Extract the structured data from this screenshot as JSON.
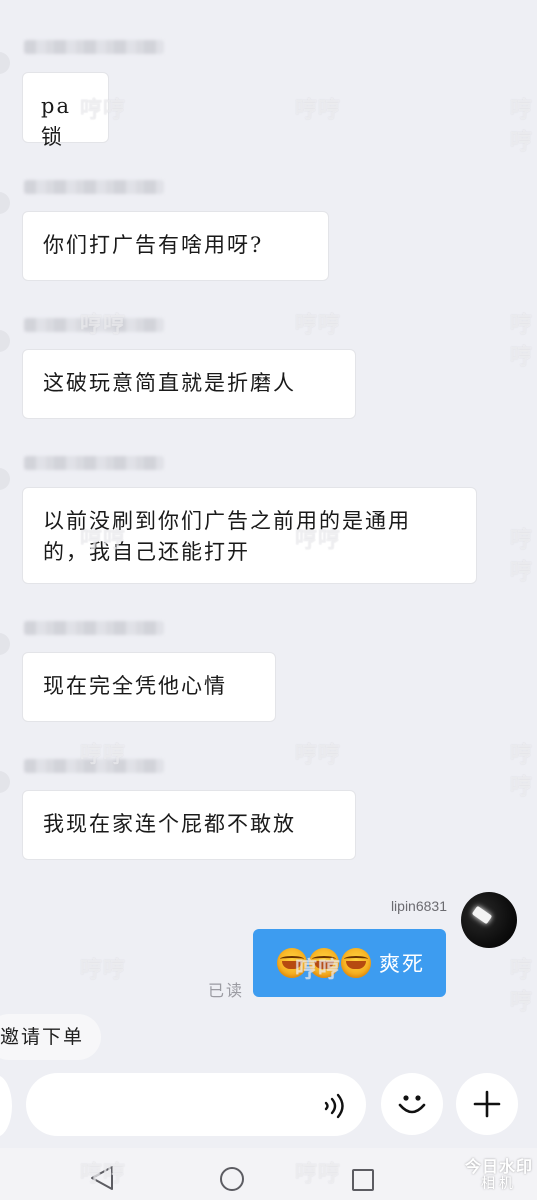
{
  "messages": [
    {
      "text": "pa锁"
    },
    {
      "text": "你们打广告有啥用呀?"
    },
    {
      "text": "这破玩意简直就是折磨人"
    },
    {
      "text": "以前没刷到你们广告之前用的是通用的，我自己还能打开"
    },
    {
      "text": "现在完全凭他心情"
    },
    {
      "text": "我现在家连个屁都不敢放"
    }
  ],
  "self_message": {
    "sender": "lipin6831",
    "text": "爽死",
    "emoji_count": 3,
    "emoji_icon": "laughing-tears-emoji",
    "status": "已读",
    "bubble_color": "#3d9cf0"
  },
  "quick_action": {
    "label": "邀请下单"
  },
  "watermark_text": "哼哼",
  "input": {
    "placeholder": "",
    "voice_icon": "voice-wave-icon",
    "emoji_button_icon": "smiley-icon",
    "plus_button_icon": "plus-icon"
  },
  "navbar": {
    "back_icon": "back-triangle-icon",
    "home_icon": "home-circle-icon",
    "recent_icon": "recent-square-icon"
  },
  "camera_watermark": {
    "line1": "今日水印",
    "line2": "相机"
  }
}
